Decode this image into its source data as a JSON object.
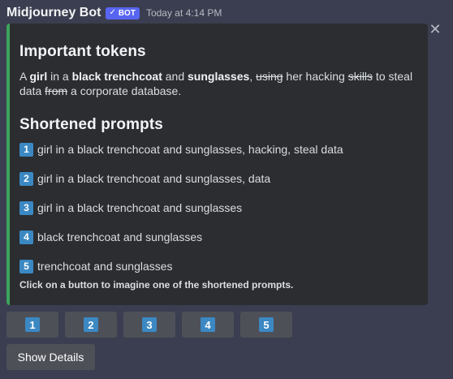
{
  "header": {
    "bot_name": "Midjourney Bot",
    "badge_label": "BOT",
    "badge_icon": "check-icon",
    "timestamp": "Today at 4:14 PM"
  },
  "embed": {
    "accent_color": "#3ba55c",
    "important_title": "Important tokens",
    "tokens_sentence": [
      {
        "text": "A ",
        "style": "normal"
      },
      {
        "text": "girl",
        "style": "bold"
      },
      {
        "text": " in a ",
        "style": "normal"
      },
      {
        "text": "black trenchcoat",
        "style": "bold"
      },
      {
        "text": " and ",
        "style": "normal"
      },
      {
        "text": "sunglasses",
        "style": "bold"
      },
      {
        "text": ", ",
        "style": "normal"
      },
      {
        "text": "using",
        "style": "strike"
      },
      {
        "text": " her hacking ",
        "style": "normal"
      },
      {
        "text": "skills",
        "style": "strike"
      },
      {
        "text": " to steal data ",
        "style": "normal"
      },
      {
        "text": "from",
        "style": "strike"
      },
      {
        "text": " a corporate database.",
        "style": "normal"
      }
    ],
    "shortened_title": "Shortened prompts",
    "prompts": [
      {
        "num": "1",
        "text": "girl in a black trenchcoat and sunglasses, hacking, steal data"
      },
      {
        "num": "2",
        "text": "girl in a black trenchcoat and sunglasses, data"
      },
      {
        "num": "3",
        "text": "girl in a black trenchcoat and sunglasses"
      },
      {
        "num": "4",
        "text": "black trenchcoat and sunglasses"
      },
      {
        "num": "5",
        "text": "trenchcoat and sunglasses"
      }
    ],
    "footer": "Click on a button to imagine one of the shortened prompts.",
    "close_icon": "close-icon"
  },
  "buttons": {
    "numbers": [
      "1",
      "2",
      "3",
      "4",
      "5"
    ],
    "details_label": "Show Details"
  }
}
